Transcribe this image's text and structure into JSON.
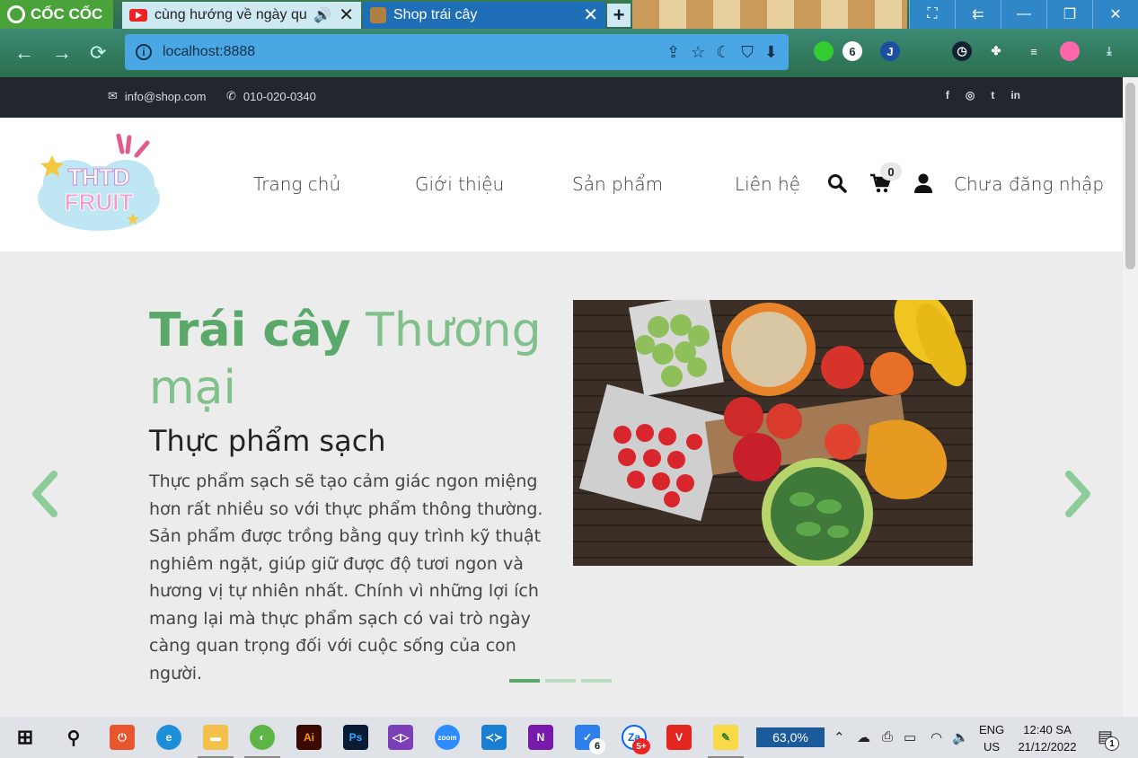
{
  "browser": {
    "brand": "CỐC CỐC",
    "tabs": [
      {
        "title": "cùng hướng về ngày quo",
        "state": "inactive"
      },
      {
        "title": "Shop trái cây",
        "state": "active"
      }
    ],
    "new_tab": "+",
    "address": "localhost:8888"
  },
  "topbar": {
    "email": "info@shop.com",
    "phone": "010-020-0340",
    "social": [
      "f",
      "◎",
      "t",
      "in"
    ]
  },
  "header": {
    "logo_line1": "THTD",
    "logo_line2": "FRUIT",
    "nav": [
      "Trang chủ",
      "Giới thiệu",
      "Sản phẩm",
      "Liên hệ"
    ],
    "cart_count": "0",
    "login_label": "Chưa đăng nhập"
  },
  "hero": {
    "title_bold": "Trái cây",
    "title_light": "Thương mại",
    "subtitle": "Thực phẩm sạch",
    "text": "Thực phẩm sạch sẽ tạo cảm giác ngon miệng hơn rất nhiều so với thực phẩm thông thường. Sản phẩm được trồng bằng quy trình kỹ thuật nghiêm ngặt, giúp giữ được độ tươi ngon và hương vị tự nhiên nhất. Chính vì những lợi ích mang lại mà thực phẩm sạch có vai trò ngày càng quan trọng đối với cuộc sống của con người.",
    "slide_active": 0,
    "slide_count": 3
  },
  "taskbar": {
    "battery": "63,0%",
    "lang1": "ENG",
    "lang2": "US",
    "time": "12:40 SA",
    "date": "21/12/2022",
    "notifications": "1",
    "badge_tasks": "6",
    "badge_zalo": "5+"
  },
  "colors": {
    "accent": "#5aa86a",
    "topbar": "#22272f",
    "hero_bg": "#ececec"
  }
}
